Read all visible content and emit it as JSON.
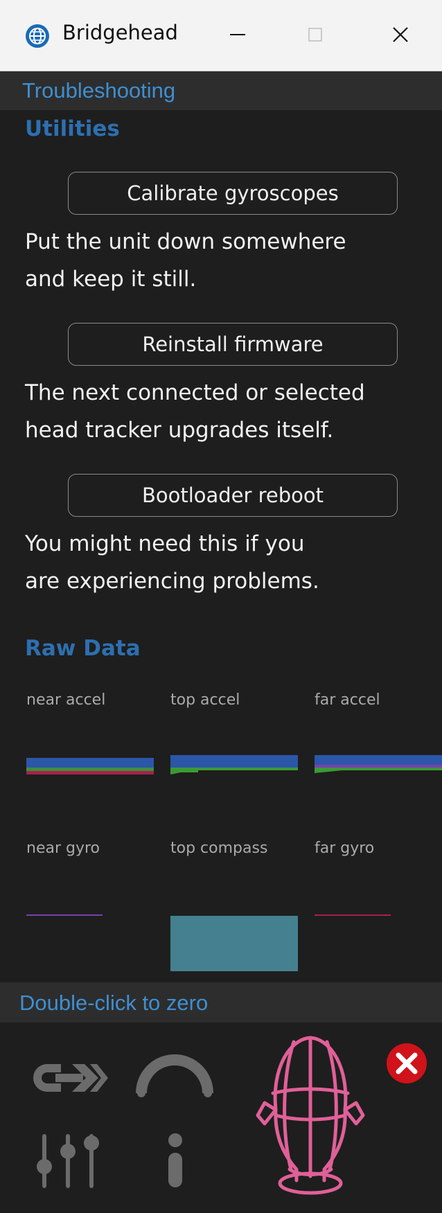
{
  "window": {
    "title": "Bridgehead",
    "icon": "globe-icon",
    "controls": [
      "minimize-icon",
      "maximize-icon",
      "close-icon"
    ]
  },
  "troubleshooting": {
    "header": "Troubleshooting",
    "utilities_heading": "Utilities",
    "calibrate": {
      "button": "Calibrate gyroscopes",
      "lines": [
        "Put the unit down somewhere",
        "and keep it still."
      ]
    },
    "firmware": {
      "button": "Reinstall firmware",
      "lines": [
        "The next connected or selected",
        "head tracker upgrades itself."
      ]
    },
    "bootloader": {
      "button": "Bootloader reboot",
      "lines": [
        "You might need this if you",
        "are experiencing problems."
      ]
    }
  },
  "raw_data": {
    "heading": "Raw Data",
    "graphs": [
      {
        "label": "near accel"
      },
      {
        "label": "top accel"
      },
      {
        "label": "far accel"
      },
      {
        "label": "near gyro"
      },
      {
        "label": "top compass"
      },
      {
        "label": "far gyro"
      }
    ]
  },
  "footer": {
    "header": "Double-click to zero",
    "icons": [
      "link-icon",
      "headphones-arc-icon",
      "sliders-icon",
      "info-icon",
      "head-cage-icon",
      "close-circle-icon"
    ]
  },
  "colors": {
    "accent": "#3f8fd1",
    "heading": "#2d6fb0",
    "background": "#1e1e1e",
    "head_outline": "#e06098",
    "close_badge": "#d0121b",
    "compass_fill": "#44808f",
    "icon_gray": "#6b6b6b"
  }
}
